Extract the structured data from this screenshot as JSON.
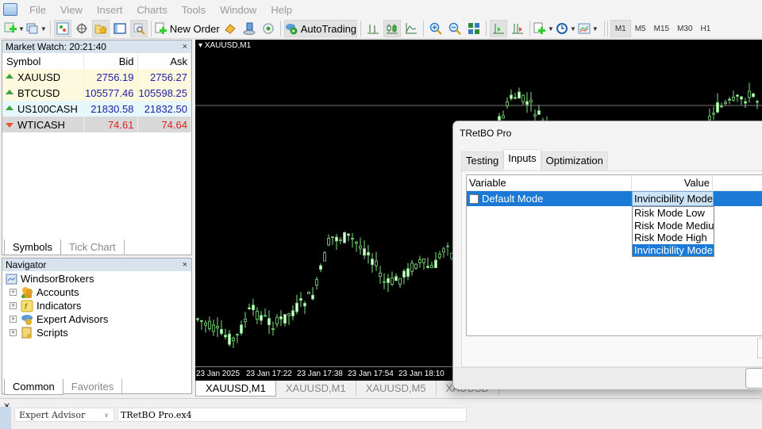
{
  "menu": [
    "File",
    "View",
    "Insert",
    "Charts",
    "Tools",
    "Window",
    "Help"
  ],
  "toolbar": {
    "new_order": "New Order",
    "autotrading": "AutoTrading",
    "timeframes": [
      "M1",
      "M5",
      "M15",
      "M30",
      "H1"
    ],
    "active_timeframe": "M1"
  },
  "market_watch": {
    "title": "Market Watch: 20:21:40",
    "close": "×",
    "columns": [
      "Symbol",
      "Bid",
      "Ask"
    ],
    "rows": [
      {
        "symbol": "XAUUSD",
        "bid": "2756.19",
        "ask": "2756.27",
        "dir": "up",
        "bg": "#fdf9df",
        "color": "#2020a0"
      },
      {
        "symbol": "BTCUSD",
        "bid": "105577.46",
        "ask": "105598.25",
        "dir": "up",
        "bg": "#fdf9df",
        "color": "#2020a0"
      },
      {
        "symbol": "US100CASH",
        "bid": "21830.58",
        "ask": "21832.50",
        "dir": "up",
        "bg": "#e6f7fd",
        "color": "#2020a0"
      },
      {
        "symbol": "WTICASH",
        "bid": "74.61",
        "ask": "74.64",
        "dir": "down",
        "bg": "#d8d8d8",
        "color": "#e02020"
      }
    ],
    "tabs": [
      "Symbols",
      "Tick Chart"
    ]
  },
  "navigator": {
    "title": "Navigator",
    "close": "×",
    "root": "WindsorBrokers",
    "items": [
      "Accounts",
      "Indicators",
      "Expert Advisors",
      "Scripts"
    ],
    "tabs": [
      "Common",
      "Favorites"
    ]
  },
  "chart": {
    "symbol_label": "XAUUSD,M1",
    "time_labels": [
      "23 Jan 2025",
      "23 Jan 17:22",
      "23 Jan 17:38",
      "23 Jan 17:54",
      "23 Jan 18:10"
    ],
    "tabs": [
      "XAUUSD,M1",
      "XAUUSD,M1",
      "XAUUSD,M5",
      "XAUUSD"
    ],
    "candle_color": "#7fe07f"
  },
  "terminal": {
    "close": "×",
    "program_type": "Expert Advisor",
    "file": "TRetBO Pro.ex4"
  },
  "dialog": {
    "title": "TRetBO Pro",
    "tabs": [
      "Testing",
      "Inputs",
      "Optimization"
    ],
    "active_tab": "Inputs",
    "columns": [
      "Variable",
      "Value"
    ],
    "row": {
      "variable": "Default Mode",
      "value": "Invincibility Mode",
      "checked": false
    },
    "options": [
      "Risk Mode Low",
      "Risk Mode Medium",
      "Risk Mode High",
      "Invincibility Mode"
    ],
    "selected_option": "Invincibility Mode"
  }
}
